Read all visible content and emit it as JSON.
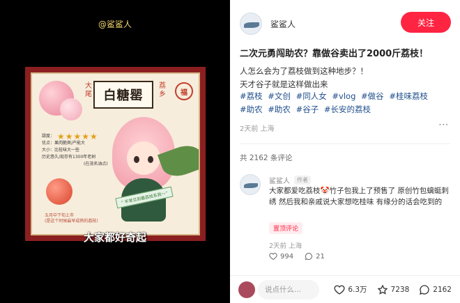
{
  "video": {
    "handle": "@鲨鲨人",
    "caption": "大家都好奇起",
    "poster": {
      "title": "白糖罂",
      "side_left": "大尾",
      "side_right": "荔乡",
      "stamp": "福",
      "rating_label": "甜度：",
      "stars": "★★★★★",
      "info_1": "优点：果肉脆爽/产能大",
      "info_2": "大小：比桂味大一些",
      "info_3": "历史悠久/现存有1300年老树",
      "info_4": "(在茂名油点)",
      "harvest_1": "五月中下旬上市",
      "harvest_2": "(是这个时候最早成熟的荔枝)",
      "ribbon": "“ 平常见到最荔枝系我～”"
    }
  },
  "note": {
    "author": "鲨鲨人",
    "follow_label": "关注",
    "title": "二次元勇闯助农？靠做谷卖出了2000斤荔枝！",
    "body_line1": "人怎么会为了荔枝做到这种地步？！",
    "body_line2": "天才谷子就是这样做出来",
    "tags": [
      "#荔枝",
      "#文创",
      "#同人女",
      "#vlog",
      "#做谷",
      "#桂味荔枝",
      "#助农",
      "#助农",
      "#谷子",
      "#长安的荔枝"
    ],
    "meta": "2天前 上海",
    "more": "···",
    "comment_count": "共 2162 条评论"
  },
  "comment": {
    "name": "鲨鲨人",
    "badge": "作者",
    "text": "大家都爱吃荔枝🤡竹子包我上了预售了 原创竹包螭蜓刺绣 然后我和亲戚说大家想吃桂味 有缘分的话会吃到的",
    "pin": "置顶评论",
    "time": "2天前 上海",
    "likes": "994",
    "replies": "21"
  },
  "bottom": {
    "input_placeholder": "说点什么...",
    "likes": "6.3万",
    "favorites": "7238",
    "comments": "2162"
  },
  "colors": {
    "accent": "#ff2442",
    "tag": "#1f4e8c"
  }
}
